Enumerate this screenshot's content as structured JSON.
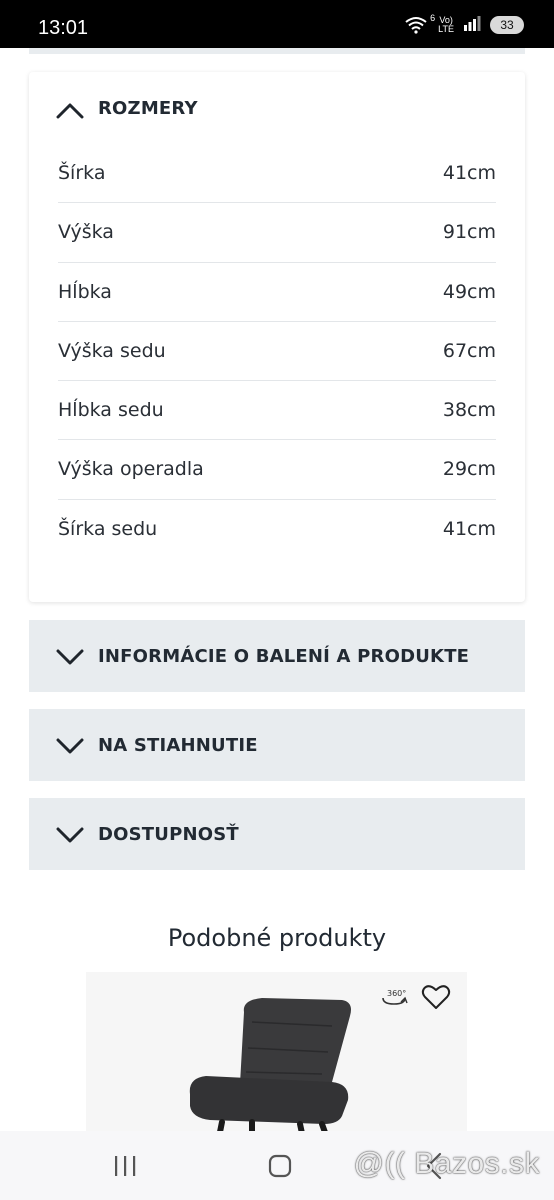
{
  "status_bar": {
    "time": "13:01",
    "wifi_badge": "6",
    "volte_top": "Vo)",
    "volte_bottom": "LTE",
    "battery": "33"
  },
  "dimensions": {
    "title": "ROZMERY",
    "rows": [
      {
        "label": "Šírka",
        "value": "41cm"
      },
      {
        "label": "Výška",
        "value": "91cm"
      },
      {
        "label": "Hĺbka",
        "value": "49cm"
      },
      {
        "label": "Výška sedu",
        "value": "67cm"
      },
      {
        "label": "Hĺbka sedu",
        "value": "38cm"
      },
      {
        "label": "Výška operadla",
        "value": "29cm"
      },
      {
        "label": "Šírka sedu",
        "value": "41cm"
      }
    ]
  },
  "accordions": [
    {
      "title": "INFORMÁCIE O BALENÍ A PRODUKTE"
    },
    {
      "title": "NA STIAHNUTIE"
    },
    {
      "title": "DOSTUPNOSŤ"
    }
  ],
  "similar": {
    "title": "Podobné produkty",
    "badge_360": "360°"
  },
  "watermark": "@(( Bazos.sk",
  "colors": {
    "accent_text": "#222a33",
    "accordion_bg": "#e8ecef",
    "nav_bg": "#f7f7f9"
  }
}
